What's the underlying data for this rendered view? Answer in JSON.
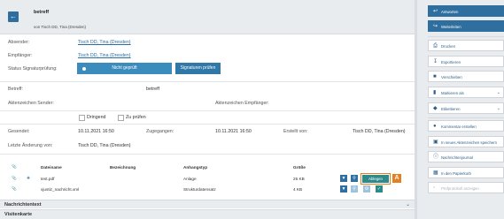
{
  "header": {
    "title": "betreff",
    "subtitle": "von Tisch DD, Tina (Dresden)"
  },
  "fields": {
    "absender_label": "Absender:",
    "absender_value": "Tisch DD, Tina (Dresden)",
    "empfaenger_label": "Empfänger:",
    "empfaenger_value": "Tisch DD, Tina (Dresden)",
    "signatur_label": "Status Signaturprüfung:",
    "signatur_status": "Nicht geprüft",
    "signatur_button": "Signaturen prüfen",
    "betreff_label": "Betreff:",
    "betreff_value": "betreff",
    "az_sender_label": "Aktenzeichen Sender:",
    "az_empf_label": "Aktenzeichen Empfänger:",
    "dringend_label": "Dringend",
    "zu_pruefen_label": "Zu prüfen",
    "gesendet_label": "Gesendet:",
    "gesendet_value": "10.11.2021 16:50",
    "zugegangen_label": "Zugegangen:",
    "zugegangen_value": "10.11.2021 16:50",
    "erstellt_label": "Erstellt von:",
    "erstellt_value": "Tisch DD, Tina (Dresden)",
    "letzte_label": "Letzte Änderung von:",
    "letzte_value": "Tisch DD, Tina (Dresden)"
  },
  "table": {
    "headers": [
      "Dateiname",
      "Bezeichnung",
      "Anhangstyp",
      "Größe"
    ],
    "rows": [
      {
        "name": "test.pdf",
        "type": "Anlage",
        "size": "26 KB"
      },
      {
        "name": "xjustiz_nachricht.xml",
        "type": "Strukturdatensatz",
        "size": "4 KB"
      }
    ],
    "ablegen_label": "Ablegen",
    "callout": "A"
  },
  "sections": {
    "nachrichtentext": "Nachrichtentext",
    "visitenkarte": "Visitenkarte"
  },
  "sidebar": {
    "items": [
      {
        "label": "Antworten",
        "icon": "reply-icon"
      },
      {
        "label": "Weiterleiten",
        "icon": "forward-icon"
      },
      {
        "label": "Drucken",
        "icon": "print-icon"
      },
      {
        "label": "Exportieren",
        "icon": "export-icon"
      },
      {
        "label": "Verschieben",
        "icon": "folder-icon"
      },
      {
        "label": "Markieren als",
        "icon": "bookmark-icon"
      },
      {
        "label": "Etikettieren",
        "icon": "tag-icon"
      },
      {
        "label": "Kommentar erstellen",
        "icon": "comment-icon"
      },
      {
        "label": "In neues Aktenzeichen speichern",
        "icon": "save-icon"
      },
      {
        "label": "Nachrichtenjournal",
        "icon": "info-icon"
      },
      {
        "label": "In den Papierkorb",
        "icon": "trash-icon"
      },
      {
        "label": "Prüfprotokoll anzeigen",
        "icon": "document-icon"
      }
    ]
  },
  "colors": {
    "primary": "#2f6f9f",
    "accent": "#e67e22",
    "teal": "#2d8a8a"
  }
}
